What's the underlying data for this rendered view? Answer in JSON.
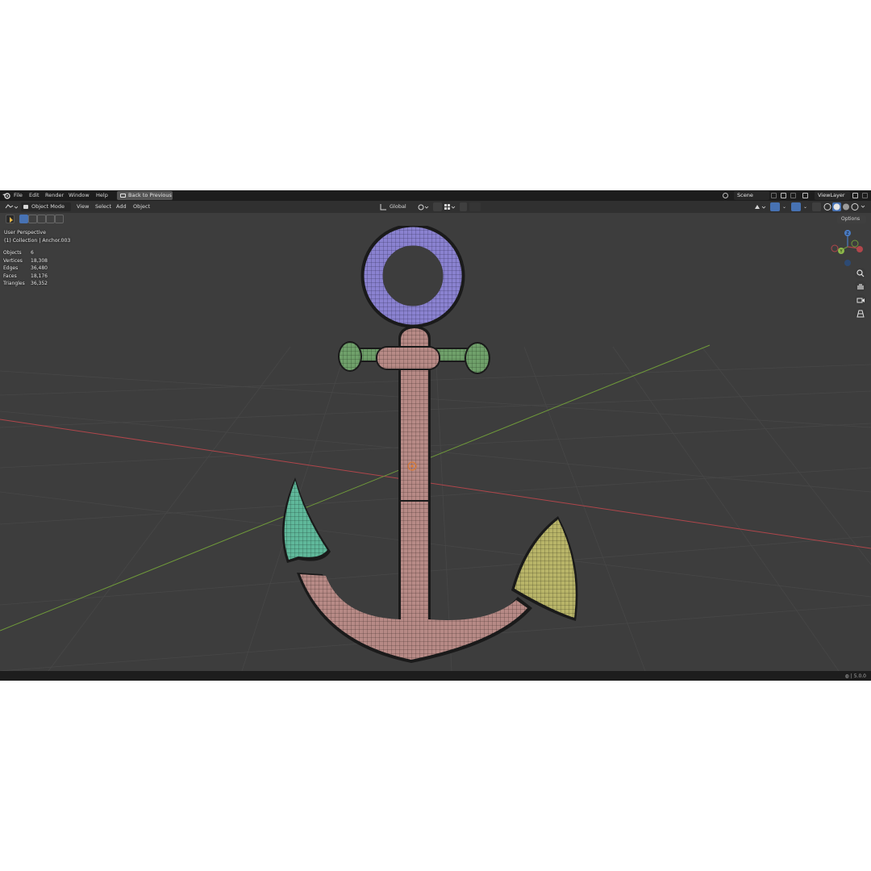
{
  "topbar": {
    "menus": [
      "File",
      "Edit",
      "Render",
      "Window",
      "Help"
    ],
    "back_button": "Back to Previous",
    "scene": "Scene",
    "view_layer": "ViewLayer"
  },
  "header": {
    "mode": "Object Mode",
    "menus": [
      "View",
      "Select",
      "Add",
      "Object"
    ],
    "transform_orientation": "Global",
    "options": "Options"
  },
  "viewport": {
    "view_name": "User Perspective",
    "collection": "(1) Collection | Anchor.003",
    "stats": [
      {
        "label": "Objects",
        "value": "6"
      },
      {
        "label": "Vertices",
        "value": "18,308"
      },
      {
        "label": "Edges",
        "value": "36,480"
      },
      {
        "label": "Faces",
        "value": "18,176"
      },
      {
        "label": "Triangles",
        "value": "36,352"
      }
    ],
    "gizmo_axes": {
      "z": "Z",
      "y": "Y"
    },
    "colors": {
      "background": "#3d3d3d",
      "x_axis": "#b0464b",
      "y_axis": "#6f9a3a",
      "ring": "#8a82d0",
      "stock": "#6fa06a",
      "shank": "#b78a86",
      "fluke_left": "#5fb89a",
      "fluke_right": "#b8b468"
    }
  },
  "statusbar": {
    "version": "5.0.0"
  }
}
